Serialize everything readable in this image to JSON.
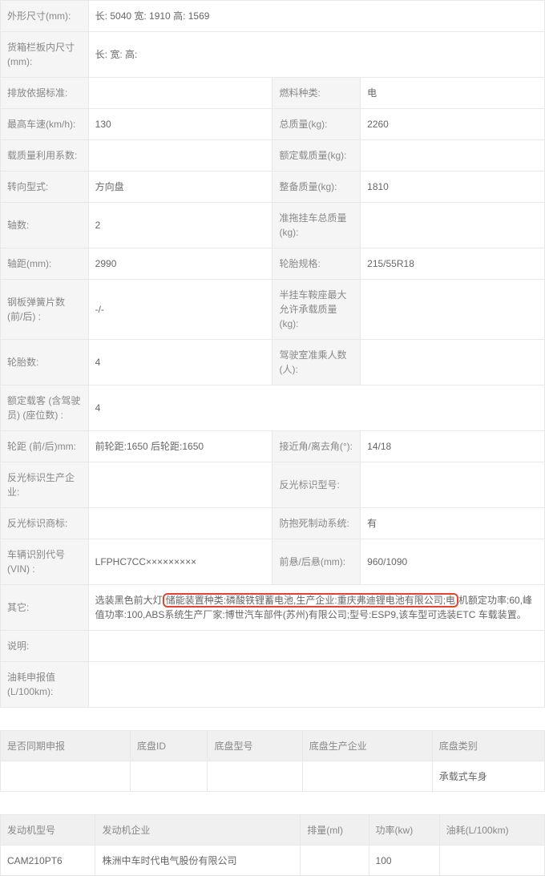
{
  "specs": {
    "r1": {
      "l1": "外形尺寸(mm):",
      "v1": "长: 5040 宽: 1910 高: 1569"
    },
    "r2": {
      "l1": "货箱栏板内尺寸(mm):",
      "v1": "长: 宽: 高:"
    },
    "r3": {
      "l1": "排放依据标准:",
      "v1": "",
      "l2": "燃料种类:",
      "v2": "电"
    },
    "r4": {
      "l1": "最高车速(km/h):",
      "v1": "130",
      "l2": "总质量(kg):",
      "v2": "2260"
    },
    "r5": {
      "l1": "载质量利用系数:",
      "v1": "",
      "l2": "额定载质量(kg):",
      "v2": ""
    },
    "r6": {
      "l1": "转向型式:",
      "v1": "方向盘",
      "l2": "整备质量(kg):",
      "v2": "1810"
    },
    "r7": {
      "l1": "轴数:",
      "v1": "2",
      "l2": "准拖挂车总质量(kg):",
      "v2": ""
    },
    "r8": {
      "l1": "轴距(mm):",
      "v1": "2990",
      "l2": "轮胎规格:",
      "v2": "215/55R18"
    },
    "r9": {
      "l1": "钢板弹簧片数 (前/后) :",
      "v1": "-/-",
      "l2": "半挂车鞍座最大允许承载质量(kg):",
      "v2": ""
    },
    "r10": {
      "l1": "轮胎数:",
      "v1": "4",
      "l2": "驾驶室准乘人数 (人):",
      "v2": ""
    },
    "r11": {
      "l1": "额定载客 (含驾驶员) (座位数) :",
      "v1": "4"
    },
    "r12": {
      "l1": "轮距 (前/后)mm:",
      "v1": "前轮距:1650 后轮距:1650",
      "l2": "接近角/离去角(°):",
      "v2": "14/18"
    },
    "r13": {
      "l1": "反光标识生产企业:",
      "v1": "",
      "l2": "反光标识型号:",
      "v2": ""
    },
    "r14": {
      "l1": "反光标识商标:",
      "v1": "",
      "l2": "防抱死制动系统:",
      "v2": "有"
    },
    "r15": {
      "l1": "车辆识别代号 (VIN) :",
      "v1": "LFPHC7CC×××××××××",
      "l2": "前悬/后悬(mm):",
      "v2": "960/1090"
    },
    "r16": {
      "l1": "其它:",
      "v1_pre": "选装黑色前大灯",
      "v1_hl": "储能装置种类:磷酸铁锂蓄电池,生产企业:重庆弗迪锂电池有限公司;电",
      "v1_post": "机额定功率:60,峰值功率:100,ABS系统生产厂家:博世汽车部件(苏州)有限公司;型号:ESP9,该车型可选装ETC 车载装置。"
    },
    "r17": {
      "l1": "说明:",
      "v1": ""
    },
    "r18": {
      "l1": "油耗申报值(L/100km):",
      "v1": ""
    }
  },
  "chassis": {
    "h0": "是否同期申报",
    "h1": "底盘ID",
    "h2": "底盘型号",
    "h3": "底盘生产企业",
    "h4": "底盘类别",
    "r0": {
      "c0": "",
      "c1": "",
      "c2": "",
      "c3": "",
      "c4": "承载式车身"
    }
  },
  "engine": {
    "h0": "发动机型号",
    "h1": "发动机企业",
    "h2": "排量(ml)",
    "h3": "功率(kw)",
    "h4": "油耗(L/100km)",
    "r0": {
      "c0": "CAM210PT6",
      "c1": "株洲中车时代电气股份有限公司",
      "c2": "",
      "c3": "100",
      "c4": ""
    }
  }
}
